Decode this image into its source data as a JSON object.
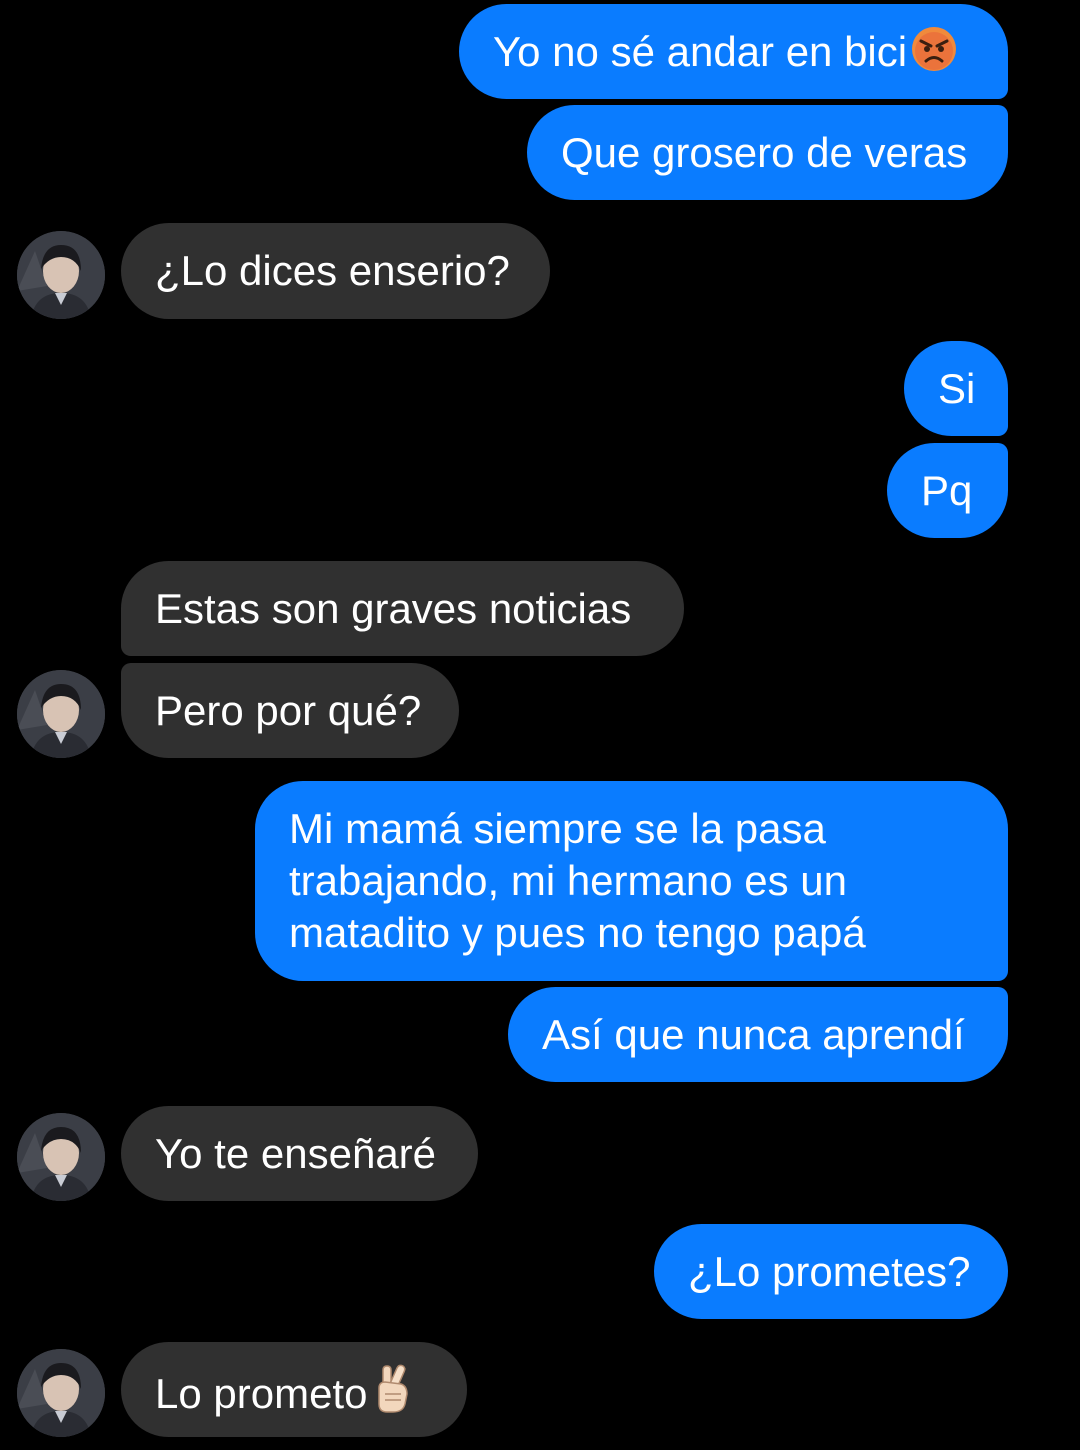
{
  "messages": [
    {
      "id": "m1",
      "side": "outgoing",
      "text": "Yo no sé andar en bici",
      "emoji": "angry-face-icon"
    },
    {
      "id": "m2",
      "side": "outgoing",
      "text": "Que grosero de veras"
    },
    {
      "id": "m3",
      "side": "incoming",
      "text": "¿Lo dices enserio?"
    },
    {
      "id": "m4",
      "side": "outgoing",
      "text": "Si"
    },
    {
      "id": "m5",
      "side": "outgoing",
      "text": "Pq"
    },
    {
      "id": "m6",
      "side": "incoming",
      "text": "Estas son graves noticias"
    },
    {
      "id": "m7",
      "side": "incoming",
      "text": "Pero por qué?"
    },
    {
      "id": "m8",
      "side": "outgoing",
      "lines": [
        "Mi mamá siempre se la pasa",
        "trabajando, mi hermano es un",
        "matadito y pues no tengo papá"
      ]
    },
    {
      "id": "m9",
      "side": "outgoing",
      "text": "Así que nunca aprendí"
    },
    {
      "id": "m10",
      "side": "incoming",
      "text": "Yo te enseñaré"
    },
    {
      "id": "m11",
      "side": "outgoing",
      "text": "¿Lo prometes?"
    },
    {
      "id": "m12",
      "side": "incoming",
      "text": "Lo prometo",
      "emoji": "crossed-fingers-icon"
    }
  ],
  "colors": {
    "background": "#000000",
    "outgoing_bubble": "#0a7cff",
    "incoming_bubble": "#303030",
    "text": "#ffffff"
  }
}
